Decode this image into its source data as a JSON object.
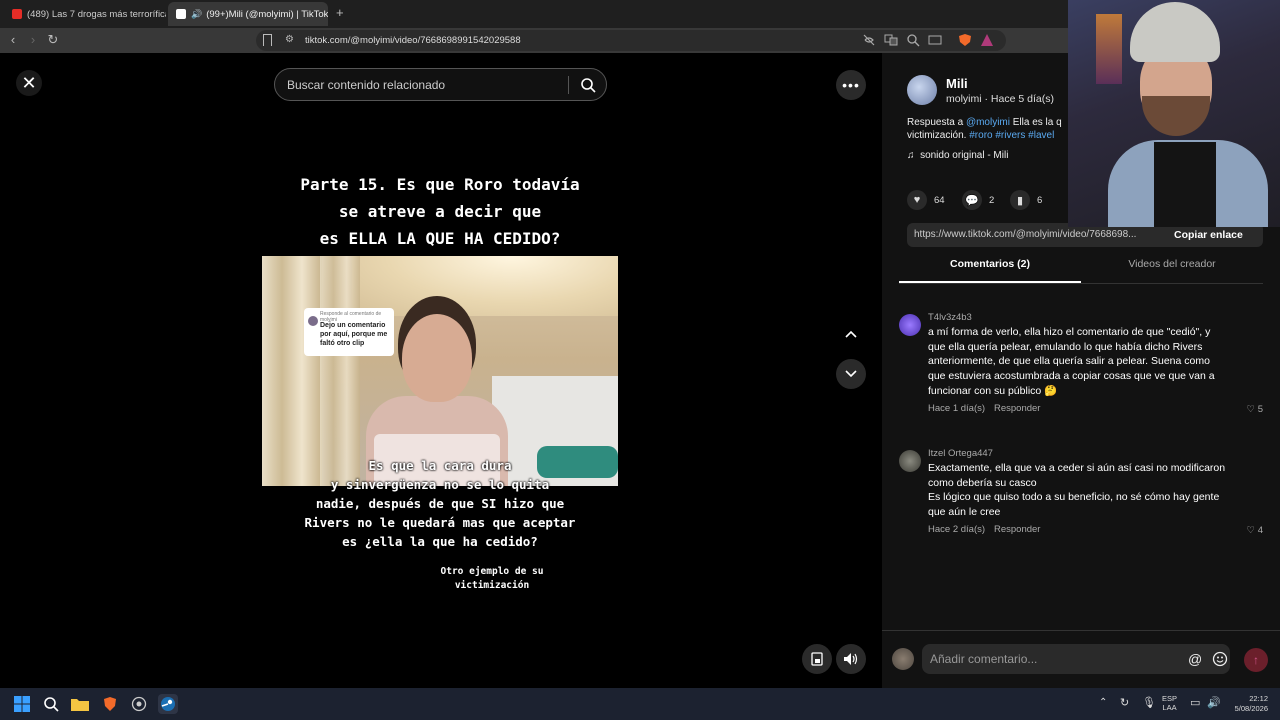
{
  "browser": {
    "tabs": [
      {
        "title": "(489) Las 7 drogas más terroríficas de",
        "active": false,
        "favicon_color": "#e52d27"
      },
      {
        "title": "(99+)Mili (@molyimi) | TikTok",
        "active": true,
        "favicon_color": "#ffffff"
      }
    ],
    "url": "tiktok.com/@molyimi/video/7668698991542029588"
  },
  "video": {
    "search_placeholder": "Buscar contenido relacionado",
    "overlay_title_lines": [
      "Parte 15. Es que Roro todavía",
      "se atreve a decir que",
      "es ELLA LA QUE HA CEDIDO?"
    ],
    "reply_bubble_small": "Responde al comentario de molyimi",
    "reply_bubble_text": "Dejo un comentario por aquí, porque me faltó otro clip",
    "caption_lines": [
      "Es que la cara dura",
      "y sinvergüenza no se lo quita",
      "nadie, después de que SI hizo que",
      "Rivers no le quedará mas que aceptar",
      "es ¿ella la que ha cedido?"
    ],
    "caption2_lines": [
      "Otro ejemplo de su",
      "victimización"
    ]
  },
  "author": {
    "name": "Mili",
    "meta": "molyimi · Hace 5 día(s)",
    "desc_prefix": "Respuesta a ",
    "desc_mention": "@molyimi",
    "desc_mid": " Ella es la q",
    "desc_line2": "victimización. ",
    "desc_tags": "#roro #rivers #lavel",
    "music": "sonido original - Mili"
  },
  "stats": {
    "likes": "64",
    "comments": "2",
    "saves": "6"
  },
  "share": {
    "url": "https://www.tiktok.com/@molyimi/video/7668698...",
    "copy_label": "Copiar enlace"
  },
  "tabs": {
    "comments": "Comentarios (2)",
    "creator": "Videos del creador"
  },
  "comments": [
    {
      "user": "T4lv3z4b3",
      "text": "a mí forma de verlo, ella hizo el comentario de que \"cedió\", y que ella quería pelear, emulando lo que había dicho Rivers anteriormente, de que ella quería salir a pelear. Suena como que estuviera acostumbrada a copiar cosas que ve que van a funcionar con su público 🤔",
      "time": "Hace 1 día(s)",
      "reply": "Responder",
      "likes": "5",
      "avatar_color": "#6a4de0"
    },
    {
      "user": "Itzel Ortega447",
      "text": "Exactamente, ella que va a ceder si aún así casi no modificaron como debería su casco\nEs lógico que quiso todo a su beneficio, no sé cómo hay gente que aún le cree",
      "time": "Hace 2 día(s)",
      "reply": "Responder",
      "likes": "4",
      "avatar_color": "#4a4a44"
    }
  ],
  "comment_input": {
    "placeholder": "Añadir comentario..."
  },
  "taskbar": {
    "lang": "ESP",
    "lang2": "LAA",
    "time": "22:12",
    "date": "5/08/2026"
  }
}
